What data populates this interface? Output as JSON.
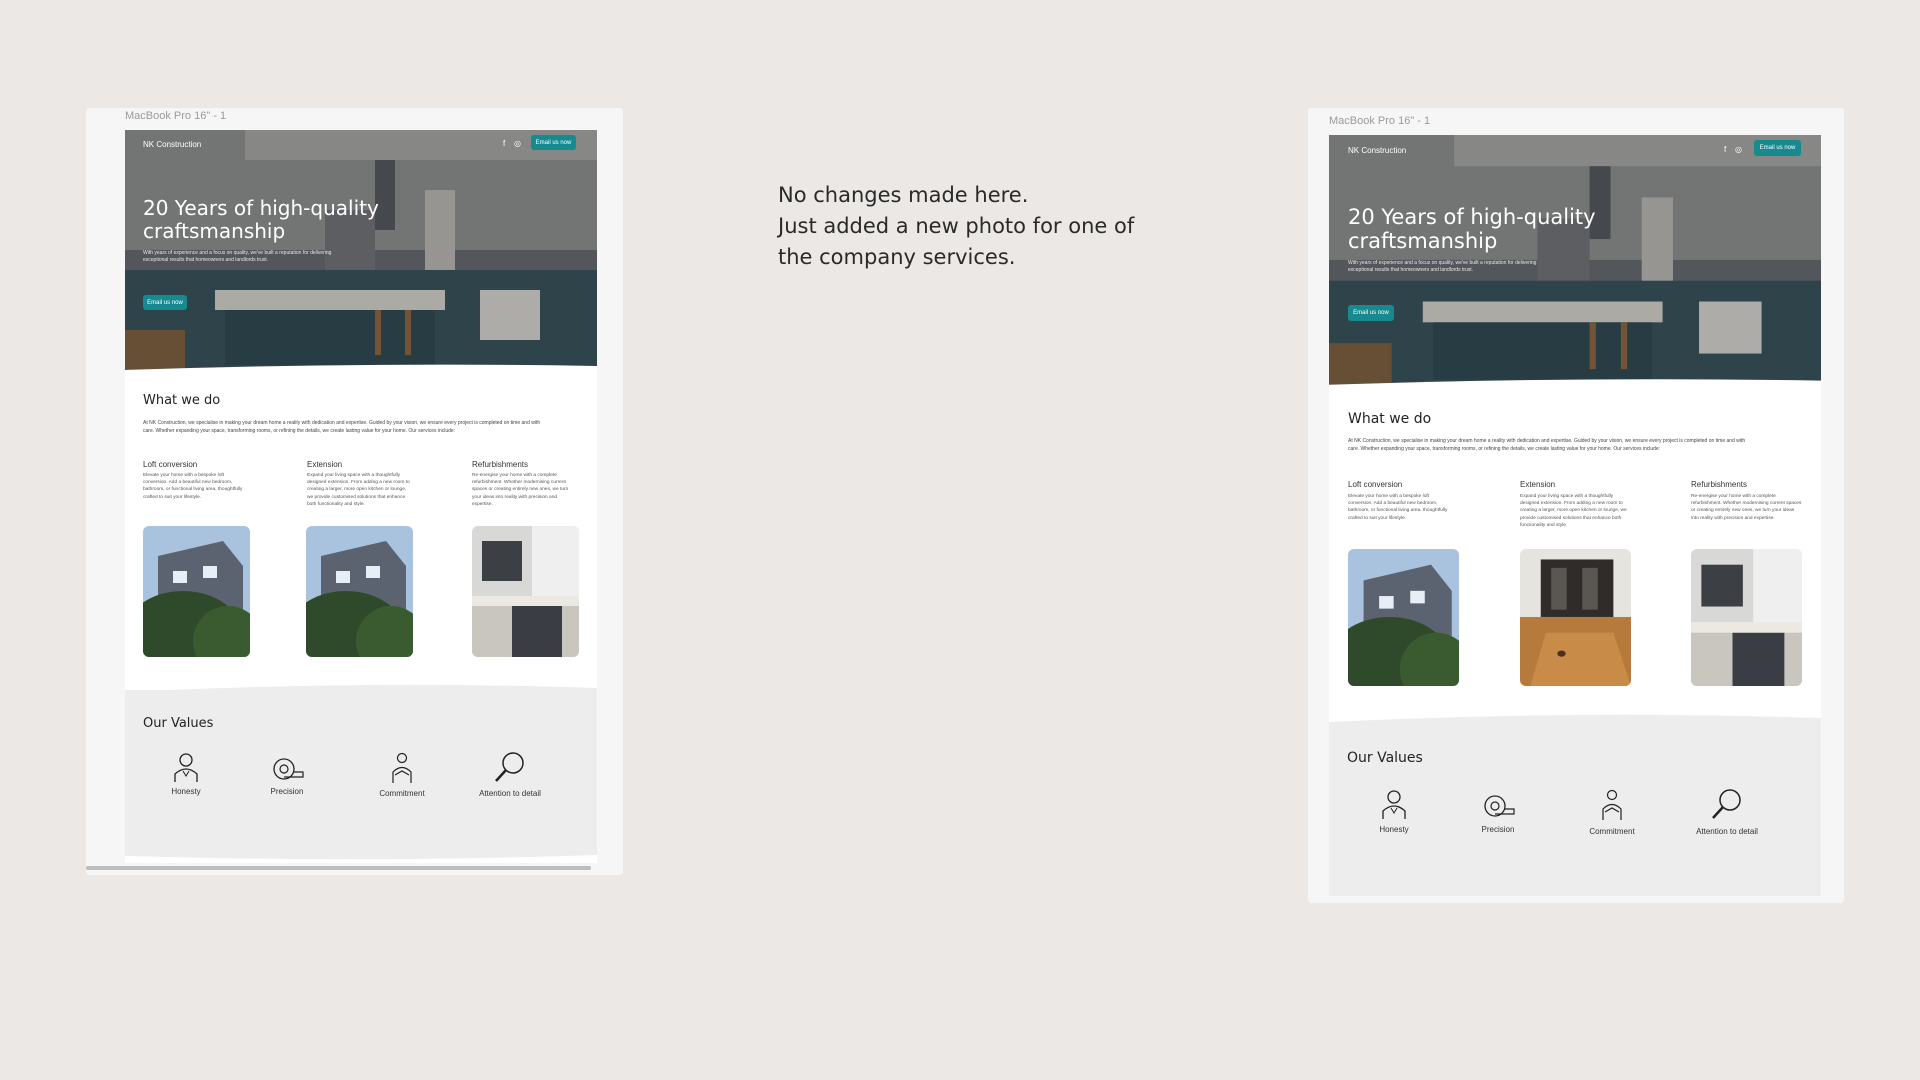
{
  "note": {
    "line1": "No changes made here.",
    "line2": "Just added a new photo for one of",
    "line3": "the company services."
  },
  "frames": {
    "label": "MacBook Pro 16\" - 1"
  },
  "site": {
    "brand": "NK Construction",
    "social_icons": [
      "facebook-icon",
      "instagram-icon"
    ],
    "email_button": "Email us now",
    "hero_title_line1": "20 Years of high-quality",
    "hero_title_line2": "craftsmanship",
    "hero_text_line1": "With years of experience and a focus on quality, we've built a reputation for delivering",
    "hero_text_line2": "exceptional results that homeowners and landlords trust.",
    "hero_button": "Email us now",
    "what_we_do": "What we do",
    "intro_line1": "At NK Construction, we specialise in making your dream home a reality with dedication and expertise. Guided by your vision, we ensure every project is completed on time and with",
    "intro_line2": "care. Whether expanding your space, transforming rooms, or refining the details, we create lasting value for your home. Our services include:",
    "services": [
      {
        "title": "Loft conversion",
        "desc": "Elevate your home with a bespoke loft conversion. Add a beautiful new bedroom, bathroom, or functional living area, thoughtfully crafted to suit your lifestyle."
      },
      {
        "title": "Extension",
        "desc": "Expand your living space with a thoughtfully designed extension. From adding a new room to creating a larger, more open kitchen or lounge, we provide customised solutions that enhance both functionality and style."
      },
      {
        "title": "Refurbishments",
        "desc": "Re-energise your home with a complete refurbishment. Whether modernising current spaces or creating entirely new ones, we turn your ideas into reality with precision and expertise."
      }
    ],
    "our_values": "Our Values",
    "values": [
      {
        "label": "Honesty",
        "icon": "person-icon"
      },
      {
        "label": "Precision",
        "icon": "tape-measure-icon"
      },
      {
        "label": "Commitment",
        "icon": "handshake-icon"
      },
      {
        "label": "Attention to detail",
        "icon": "magnifier-icon"
      }
    ],
    "accent_color": "#178a8f"
  }
}
